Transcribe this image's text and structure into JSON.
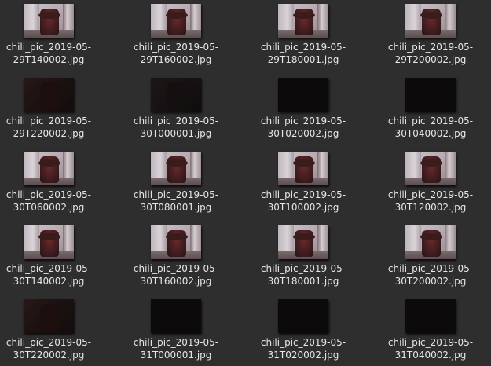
{
  "files": [
    {
      "line1": "chili_pic_2019-05-",
      "line2": "29T140002.jpg",
      "shade": "day"
    },
    {
      "line1": "chili_pic_2019-05-",
      "line2": "29T160002.jpg",
      "shade": "day"
    },
    {
      "line1": "chili_pic_2019-05-",
      "line2": "29T180001.jpg",
      "shade": "day"
    },
    {
      "line1": "chili_pic_2019-05-",
      "line2": "29T200002.jpg",
      "shade": "day"
    },
    {
      "line1": "chili_pic_2019-05-",
      "line2": "29T220002.jpg",
      "shade": "dusk"
    },
    {
      "line1": "chili_pic_2019-05-",
      "line2": "30T000001.jpg",
      "shade": "dim"
    },
    {
      "line1": "chili_pic_2019-05-",
      "line2": "30T020002.jpg",
      "shade": "dark"
    },
    {
      "line1": "chili_pic_2019-05-",
      "line2": "30T040002.jpg",
      "shade": "dark"
    },
    {
      "line1": "chili_pic_2019-05-",
      "line2": "30T060002.jpg",
      "shade": "day"
    },
    {
      "line1": "chili_pic_2019-05-",
      "line2": "30T080001.jpg",
      "shade": "day"
    },
    {
      "line1": "chili_pic_2019-05-",
      "line2": "30T100002.jpg",
      "shade": "day"
    },
    {
      "line1": "chili_pic_2019-05-",
      "line2": "30T120002.jpg",
      "shade": "day"
    },
    {
      "line1": "chili_pic_2019-05-",
      "line2": "30T140002.jpg",
      "shade": "day"
    },
    {
      "line1": "chili_pic_2019-05-",
      "line2": "30T160002.jpg",
      "shade": "day"
    },
    {
      "line1": "chili_pic_2019-05-",
      "line2": "30T180001.jpg",
      "shade": "day"
    },
    {
      "line1": "chili_pic_2019-05-",
      "line2": "30T200002.jpg",
      "shade": "day"
    },
    {
      "line1": "chili_pic_2019-05-",
      "line2": "30T220002.jpg",
      "shade": "dusk"
    },
    {
      "line1": "chili_pic_2019-05-",
      "line2": "31T000001.jpg",
      "shade": "dark"
    },
    {
      "line1": "chili_pic_2019-05-",
      "line2": "31T020002.jpg",
      "shade": "dark"
    },
    {
      "line1": "chili_pic_2019-05-",
      "line2": "31T040002.jpg",
      "shade": "dark"
    }
  ]
}
